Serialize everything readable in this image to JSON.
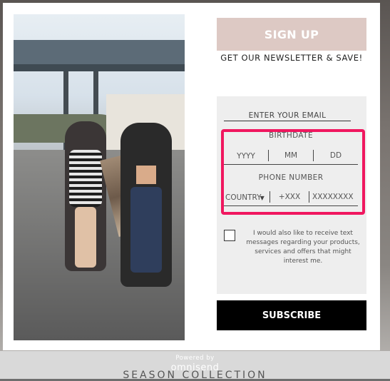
{
  "popup": {
    "signup_label": "SIGN UP",
    "tagline": "GET OUR NEWSLETTER & SAVE!",
    "email_placeholder": "ENTER YOUR EMAIL",
    "birthdate_label": "BIRTHDATE",
    "birthdate_fields": {
      "year": "YYYY",
      "month": "MM",
      "day": "DD"
    },
    "phone_label": "PHONE NUMBER",
    "phone_fields": {
      "country": "COUNTRY",
      "code": "+XXX",
      "number": "XXXXXXXX"
    },
    "consent_text": "I would also like to receive text messages regarding your products, services and offers that might interest me.",
    "subscribe_label": "SUBSCRIBE",
    "consent_checked": false
  },
  "footer": {
    "powered_by": "Powered by",
    "brand": "omnisend"
  },
  "background": {
    "section_text": "SEASON COLLECTION"
  },
  "colors": {
    "signup_button": "#ddc9c4",
    "highlight": "#f0175f",
    "subscribe_button": "#000000",
    "form_panel": "#eeeeee"
  }
}
